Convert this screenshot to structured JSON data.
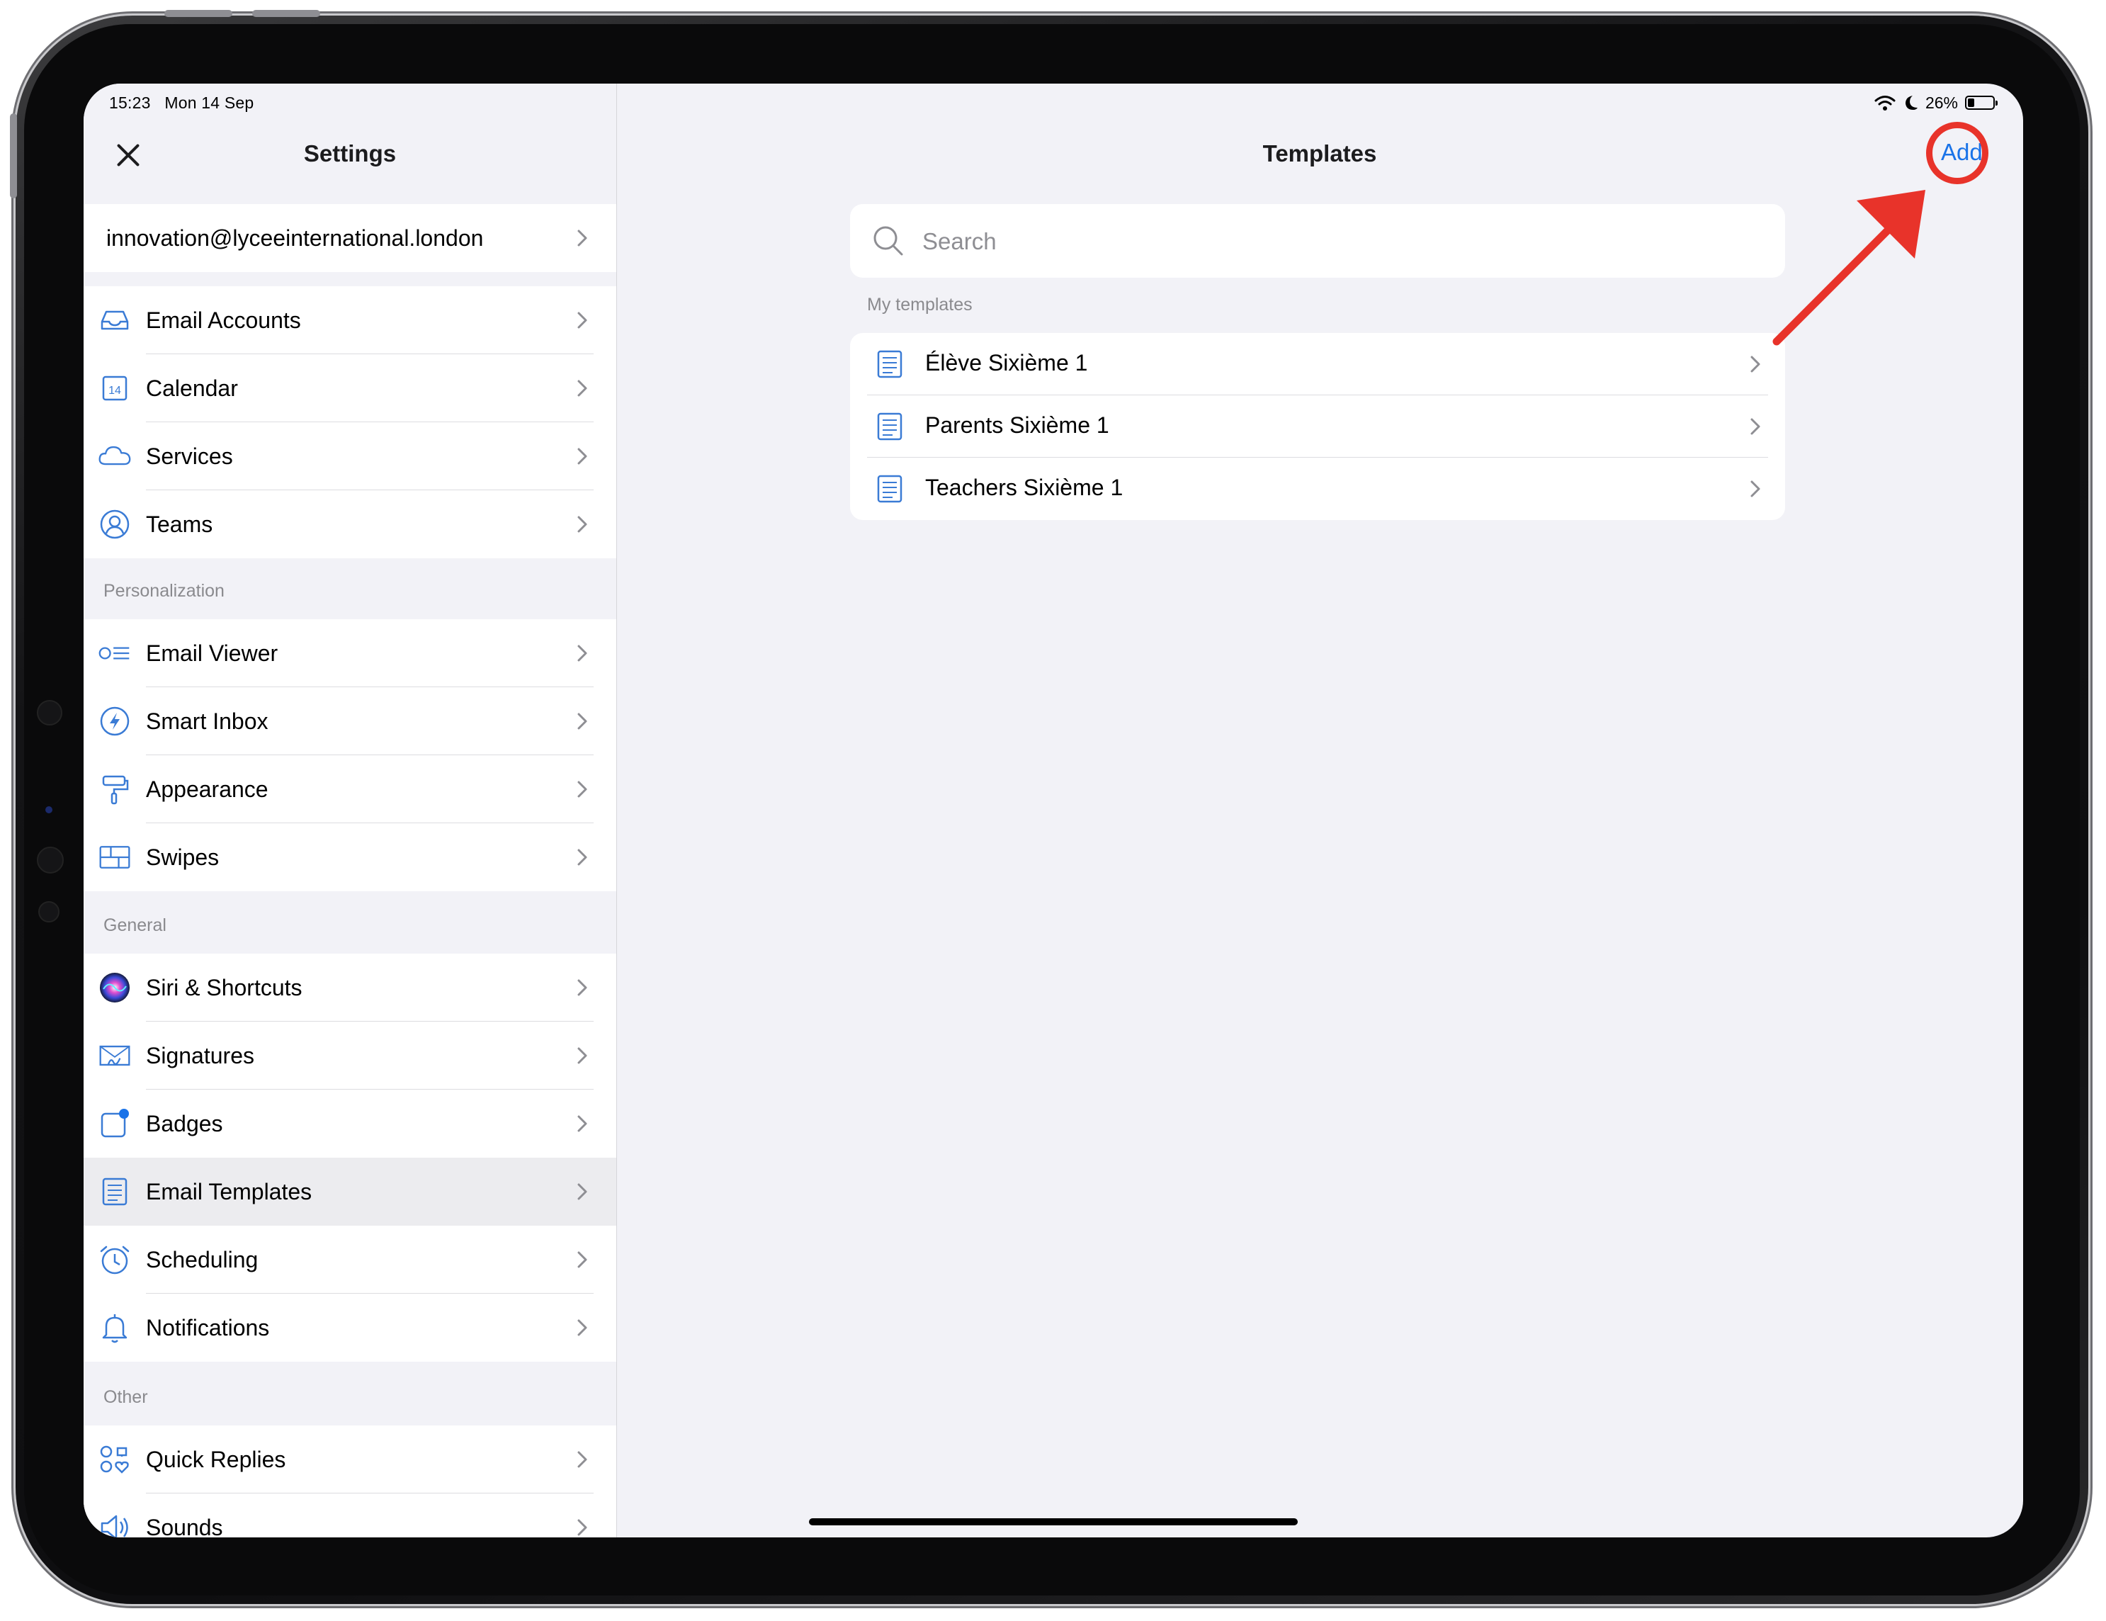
{
  "status_bar": {
    "time": "15:23",
    "date": "Mon 14 Sep",
    "battery_percent": "26%",
    "battery_level": 0.26
  },
  "sidebar": {
    "title": "Settings",
    "account": "innovation@lyceeinternational.london",
    "groups": [
      {
        "header": "",
        "items": [
          {
            "label": "Email Accounts",
            "icon": "inbox-tray-icon"
          },
          {
            "label": "Calendar",
            "icon": "calendar-icon",
            "icon_text": "14"
          },
          {
            "label": "Services",
            "icon": "cloud-icon"
          },
          {
            "label": "Teams",
            "icon": "user-circle-icon"
          }
        ]
      },
      {
        "header": "Personalization",
        "items": [
          {
            "label": "Email Viewer",
            "icon": "email-viewer-icon"
          },
          {
            "label": "Smart Inbox",
            "icon": "lightning-bolt-icon"
          },
          {
            "label": "Appearance",
            "icon": "paint-roller-icon"
          },
          {
            "label": "Swipes",
            "icon": "swipes-grid-icon"
          }
        ]
      },
      {
        "header": "General",
        "items": [
          {
            "label": "Siri & Shortcuts",
            "icon": "siri-icon"
          },
          {
            "label": "Signatures",
            "icon": "signature-icon"
          },
          {
            "label": "Badges",
            "icon": "badge-icon"
          },
          {
            "label": "Email Templates",
            "icon": "document-icon",
            "selected": true
          },
          {
            "label": "Scheduling",
            "icon": "alarm-clock-icon"
          },
          {
            "label": "Notifications",
            "icon": "bell-icon"
          }
        ]
      },
      {
        "header": "Other",
        "items": [
          {
            "label": "Quick Replies",
            "icon": "quick-replies-icon"
          },
          {
            "label": "Sounds",
            "icon": "speaker-icon"
          }
        ]
      }
    ]
  },
  "main": {
    "title": "Templates",
    "add_label": "Add",
    "search_placeholder": "Search",
    "section_header": "My templates",
    "templates": [
      "Élève Sixième 1",
      "Parents Sixième 1",
      "Teachers Sixième 1"
    ]
  },
  "colors": {
    "accent": "#1a73e8",
    "icon_blue": "#3a7bd5",
    "annotation_red": "#e8332a",
    "background": "#f2f2f7"
  }
}
